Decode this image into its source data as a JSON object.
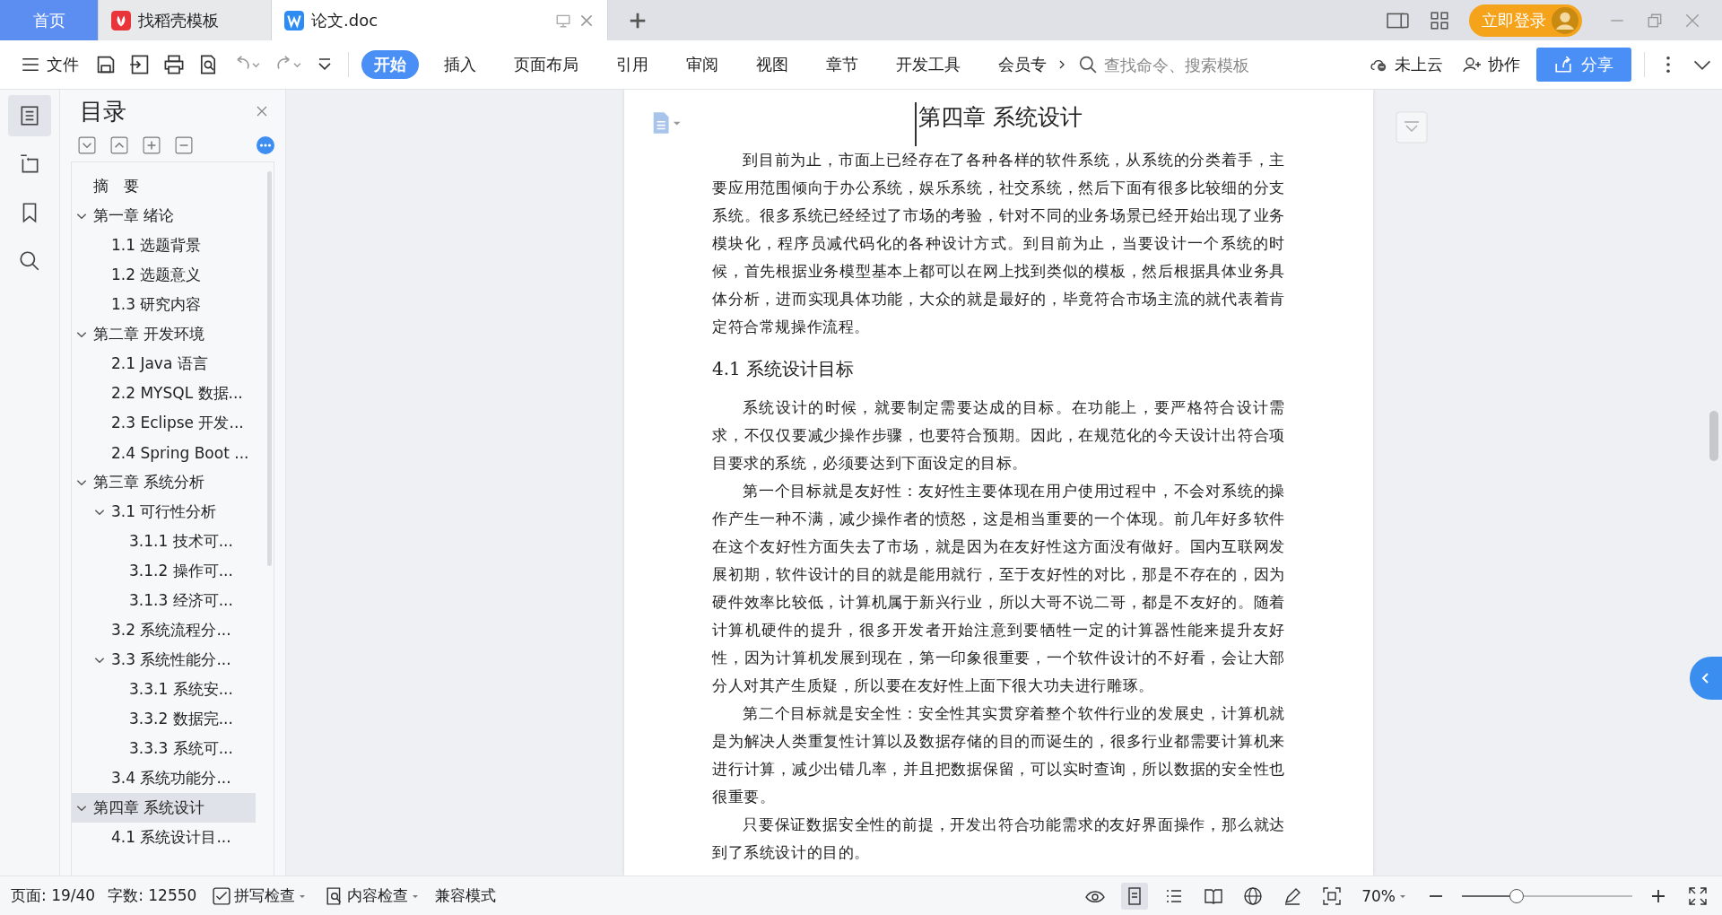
{
  "tabs": [
    {
      "label": "首页",
      "kind": "home",
      "selected": false
    },
    {
      "label": "找稻壳模板",
      "kind": "docer",
      "selected": false
    },
    {
      "label": "论文.doc",
      "kind": "doc",
      "selected": true
    }
  ],
  "login_button": "立即登录",
  "toolbar": {
    "file_menu": "文件",
    "ribbon_tabs": [
      {
        "label": "开始",
        "selected": true
      },
      {
        "label": "插入",
        "selected": false
      },
      {
        "label": "页面布局",
        "selected": false
      },
      {
        "label": "引用",
        "selected": false
      },
      {
        "label": "审阅",
        "selected": false
      },
      {
        "label": "视图",
        "selected": false
      },
      {
        "label": "章节",
        "selected": false
      },
      {
        "label": "开发工具",
        "selected": false
      },
      {
        "label": "会员专",
        "selected": false
      }
    ],
    "search": {
      "placeholder": "查找命令、搜索模板"
    },
    "cloud": "未上云",
    "collaborate": "协作",
    "share": "分享"
  },
  "sidebar_rail": [
    {
      "kind": "toc",
      "selected": true
    },
    {
      "kind": "outline",
      "selected": false
    },
    {
      "kind": "bookmark",
      "selected": false
    },
    {
      "kind": "search",
      "selected": false
    }
  ],
  "toc": {
    "title": "目录",
    "items": [
      {
        "label": "摘　要",
        "selected": false
      },
      {
        "label": "第一章  绪论",
        "selected": false,
        "expanded": true,
        "children": [
          {
            "label": "1.1  选题背景",
            "selected": false
          },
          {
            "label": "1.2  选题意义",
            "selected": false
          },
          {
            "label": "1.3  研究内容",
            "selected": false
          }
        ]
      },
      {
        "label": "第二章  开发环境",
        "selected": false,
        "expanded": true,
        "children": [
          {
            "label": "2.1 Java 语言",
            "selected": false
          },
          {
            "label": "2.2 MYSQL 数据...",
            "selected": false
          },
          {
            "label": "2.3 Eclipse 开发...",
            "selected": false
          },
          {
            "label": "2.4 Spring Boot ...",
            "selected": false
          }
        ]
      },
      {
        "label": "第三章  系统分析",
        "selected": false,
        "expanded": true,
        "children": [
          {
            "label": "3.1 可行性分析",
            "selected": false,
            "expanded": true,
            "children": [
              {
                "label": "3.1.1 技术可...",
                "selected": false
              },
              {
                "label": "3.1.2 操作可...",
                "selected": false
              },
              {
                "label": "3.1.3 经济可...",
                "selected": false
              }
            ]
          },
          {
            "label": "3.2 系统流程分...",
            "selected": false
          },
          {
            "label": "3.3 系统性能分...",
            "selected": false,
            "expanded": true,
            "children": [
              {
                "label": "3.3.1 系统安...",
                "selected": false
              },
              {
                "label": "3.3.2 数据完...",
                "selected": false
              },
              {
                "label": "3.3.3 系统可...",
                "selected": false
              }
            ]
          },
          {
            "label": "3.4 系统功能分...",
            "selected": false
          }
        ]
      },
      {
        "label": "第四章  系统设计",
        "selected": true,
        "expanded": true,
        "children": [
          {
            "label": "4.1  系统设计目...",
            "selected": false
          }
        ]
      }
    ]
  },
  "document": {
    "heading": "第四章  系统设计",
    "blocks": [
      {
        "kind": "paragraph",
        "text": "到目前为止，市面上已经存在了各种各样的软件系统，从系统的分类着手，主要应用范围倾向于办公系统，娱乐系统，社交系统，然后下面有很多比较细的分支系统。很多系统已经经过了市场的考验，针对不同的业务场景已经开始出现了业务模块化，程序员减代码化的各种设计方式。到目前为止，当要设计一个系统的时候，首先根据业务模型基本上都可以在网上找到类似的模板，然后根据具体业务具体分析，进而实现具体功能，大众的就是最好的，毕竟符合市场主流的就代表着肯定符合常规操作流程。"
      },
      {
        "kind": "section",
        "text": "4.1  系统设计目标"
      },
      {
        "kind": "paragraph",
        "text": "系统设计的时候，就要制定需要达成的目标。在功能上，要严格符合设计需求，不仅仅要减少操作步骤，也要符合预期。因此，在规范化的今天设计出符合项目要求的系统，必须要达到下面设定的目标。"
      },
      {
        "kind": "paragraph",
        "text": "第一个目标就是友好性：友好性主要体现在用户使用过程中，不会对系统的操作产生一种不满，减少操作者的愤怒，这是相当重要的一个体现。前几年好多软件在这个友好性方面失去了市场，就是因为在友好性这方面没有做好。国内互联网发展初期，软件设计的目的就是能用就行，至于友好性的对比，那是不存在的，因为硬件效率比较低，计算机属于新兴行业，所以大哥不说二哥，都是不友好的。随着计算机硬件的提升，很多开发者开始注意到要牺牲一定的计算器性能来提升友好性，因为计算机发展到现在，第一印象很重要，一个软件设计的不好看，会让大部分人对其产生质疑，所以要在友好性上面下很大功夫进行雕琢。"
      },
      {
        "kind": "paragraph",
        "text": "第二个目标就是安全性：安全性其实贯穿着整个软件行业的发展史，计算机就是为解决人类重复性计算以及数据存储的目的而诞生的，很多行业都需要计算机来进行计算，减少出错几率，并且把数据保留，可以实时查询，所以数据的安全性也很重要。"
      },
      {
        "kind": "paragraph",
        "text": "只要保证数据安全性的前提，开发出符合功能需求的友好界面操作，那么就达到了系统设计的目的。"
      }
    ]
  },
  "status_bar": {
    "page": "页面: 19/40",
    "words": "字数: 12550",
    "spell_check": "拼写检查",
    "content_check": "内容检查",
    "compat_mode": "兼容模式",
    "zoom": "70%",
    "zoom_slider": {
      "level": 0.32
    }
  }
}
